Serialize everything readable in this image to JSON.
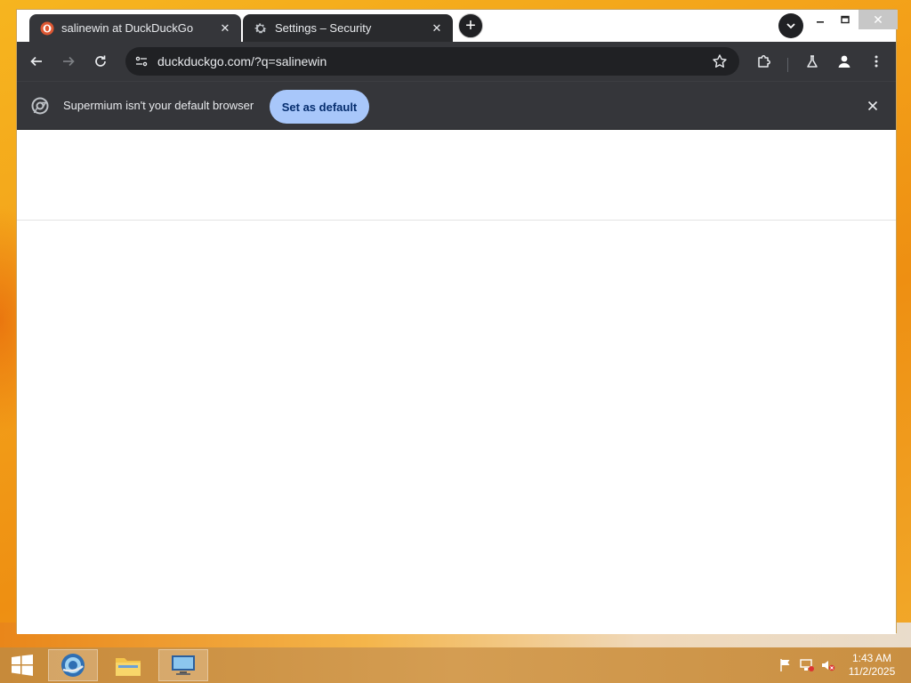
{
  "browser": {
    "tabs": [
      {
        "title": "salinewin at DuckDuckGo",
        "active": true,
        "icon": "duckduckgo-icon"
      },
      {
        "title": "Settings – Security",
        "active": false,
        "icon": "gear-icon"
      }
    ],
    "address": {
      "url": "duckduckgo.com/?q=salinewin"
    },
    "infobar": {
      "message": "Supermium isn't your default browser",
      "button_label": "Set as default"
    }
  },
  "taskbar": {
    "clock": {
      "time": "1:43 AM",
      "date": "11/2/2025"
    }
  },
  "colors": {
    "accent": "#a8c7fa",
    "toolbar": "#35363a",
    "tab_active": "#35363a",
    "desktop": "#f3a019"
  }
}
